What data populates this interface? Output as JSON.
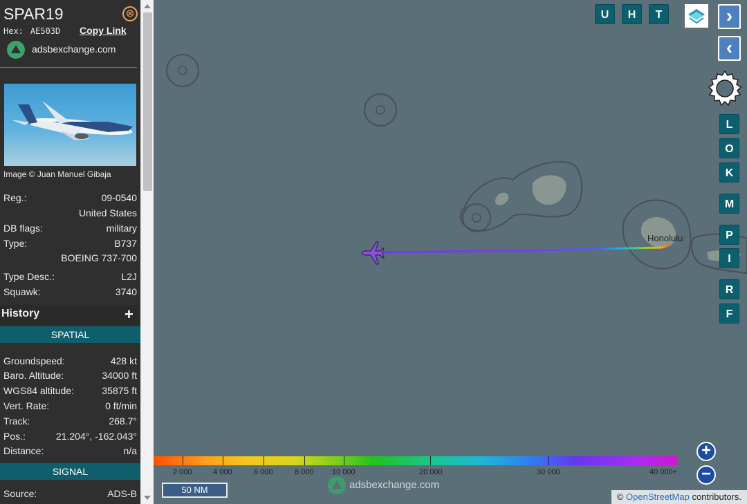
{
  "sidebar": {
    "callsign": "SPAR19",
    "close_symbol": "⊗",
    "hex_label": "Hex:",
    "hex_value": "AE503D",
    "copy_link": "Copy Link",
    "source_name": "adsbexchange.com",
    "image_credit": "Image © Juan Manuel Gibaja",
    "info": {
      "reg_label": "Reg.:",
      "reg_value": "09-0540",
      "country": "United States",
      "dbflags_label": "DB flags:",
      "dbflags_value": "military",
      "type_label": "Type:",
      "type_value": "B737",
      "type_name": "BOEING 737-700",
      "typedesc_label": "Type Desc.:",
      "typedesc_value": "L2J",
      "squawk_label": "Squawk:",
      "squawk_value": "3740"
    },
    "history_title": "History",
    "history_plus": "+",
    "spatial_title": "SPATIAL",
    "spatial": {
      "groundspeed_label": "Groundspeed:",
      "groundspeed_value": "428 kt",
      "baro_label": "Baro. Altitude:",
      "baro_value": "34000 ft",
      "wgs_label": "WGS84 altitude:",
      "wgs_value": "35875 ft",
      "vert_label": "Vert. Rate:",
      "vert_value": "0 ft/min",
      "track_label": "Track:",
      "track_value": "268.7°",
      "pos_label": "Pos.:",
      "pos_value": "21.204°, -162.043°",
      "distance_label": "Distance:",
      "distance_value": "n/a"
    },
    "signal_title": "SIGNAL",
    "signal": {
      "source_label": "Source:",
      "source_value": "ADS-B"
    }
  },
  "map": {
    "city_label": "Honolulu",
    "top_buttons": [
      "U",
      "H",
      "T"
    ],
    "nav_next": "›",
    "nav_prev": "‹",
    "side_buttons": [
      "L",
      "O",
      "K",
      "M",
      "P",
      "I",
      "R",
      "F"
    ],
    "zoom_in": "+",
    "zoom_out": "−",
    "altitude_ticks": [
      "2 000",
      "4 000",
      "6 000",
      "8 000",
      "10 000",
      "20 000",
      "30 000",
      "40 000+"
    ],
    "scale_label": "50 NM",
    "watermark": "adsbexchange.com",
    "attribution_prefix": "©",
    "attribution_link": "OpenStreetMap",
    "attribution_suffix": "contributors.",
    "colors": {
      "sidebar_bg": "#2f2f2f",
      "section_head": "#0e5f6b",
      "map_bg": "#5b6f78",
      "button": "#0d5f6d",
      "aircraft": "#8a4fd8"
    },
    "icons": [
      "close-icon",
      "adsbexchange-logo-icon",
      "plus-icon",
      "layers-icon",
      "chevron-right-icon",
      "chevron-left-icon",
      "gear-icon",
      "aircraft-icon",
      "zoom-in-icon",
      "zoom-out-icon"
    ]
  }
}
